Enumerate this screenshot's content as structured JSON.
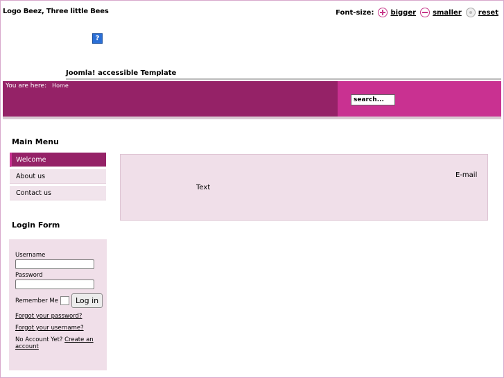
{
  "header": {
    "logo": "Logo Beez, Three little Bees",
    "tagline": "Joomla! accessible Template",
    "fontsize": {
      "label": "Font-size:",
      "bigger": "bigger",
      "smaller": "smaller",
      "reset": "reset"
    },
    "help_icon_glyph": "?"
  },
  "breadcrumb": {
    "prefix": "You are here:",
    "home": "Home"
  },
  "search": {
    "value": "search..."
  },
  "main_menu": {
    "title": "Main Menu",
    "items": [
      {
        "label": "Welcome",
        "active": true
      },
      {
        "label": "About us"
      },
      {
        "label": "Contact us"
      }
    ]
  },
  "content": {
    "email_label": "E-mail",
    "text_label": "Text"
  },
  "login": {
    "title": "Login Form",
    "username_label": "Username",
    "password_label": "Password",
    "remember_label": "Remember Me",
    "login_button": "Log in",
    "forgot_password": "Forgot your password?",
    "forgot_username": "Forgot your username?",
    "no_account": "No Account Yet?",
    "create_account": "Create an account"
  },
  "colors": {
    "primary": "#952267",
    "accent": "#c93191",
    "light": "#f0dfe9"
  }
}
